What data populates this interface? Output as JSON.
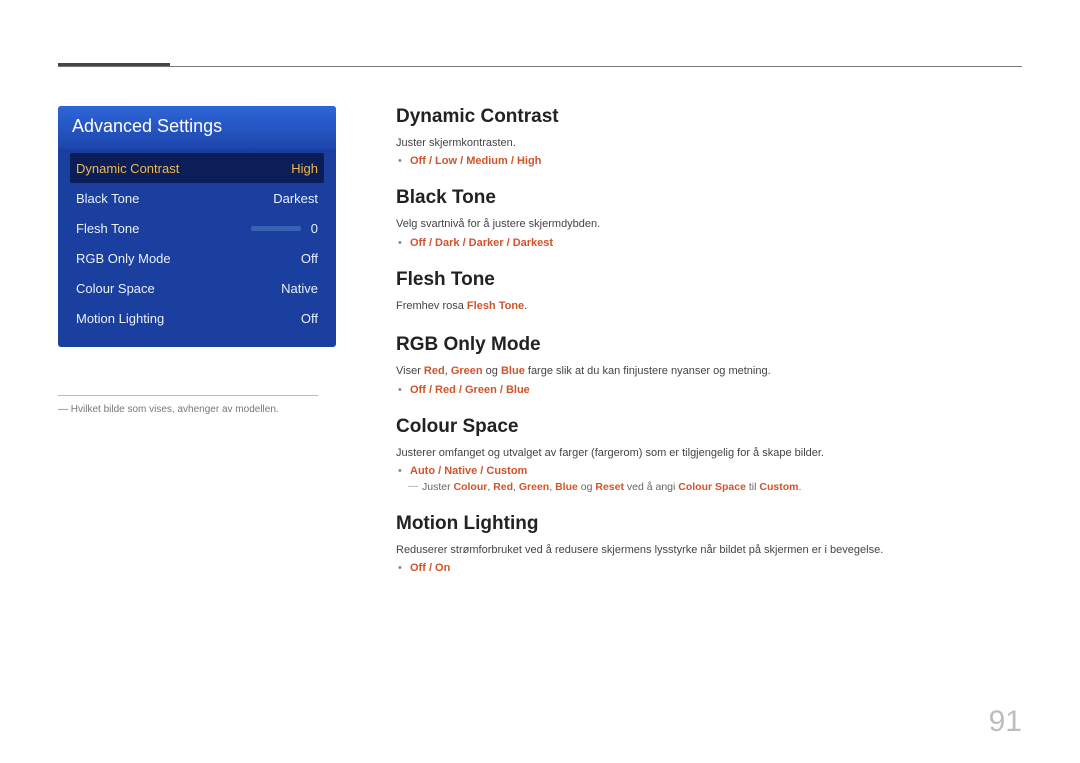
{
  "panel": {
    "title": "Advanced Settings",
    "rows": [
      {
        "label": "Dynamic Contrast",
        "value": "High",
        "selected": true
      },
      {
        "label": "Black Tone",
        "value": "Darkest"
      },
      {
        "label": "Flesh Tone",
        "value": "0",
        "slider": 50
      },
      {
        "label": "RGB Only Mode",
        "value": "Off"
      },
      {
        "label": "Colour Space",
        "value": "Native"
      },
      {
        "label": "Motion Lighting",
        "value": "Off"
      }
    ]
  },
  "footnote_prefix": "―",
  "footnote": "Hvilket bilde som vises, avhenger av modellen.",
  "sections": {
    "dynamic_contrast": {
      "title": "Dynamic Contrast",
      "desc": "Juster skjermkontrasten.",
      "options": "Off / Low / Medium / High"
    },
    "black_tone": {
      "title": "Black Tone",
      "desc": "Velg svartnivå for å justere skjermdybden.",
      "options": "Off / Dark / Darker / Darkest"
    },
    "flesh_tone": {
      "title": "Flesh Tone",
      "desc_pre": "Fremhev rosa ",
      "desc_bold": "Flesh Tone",
      "desc_post": "."
    },
    "rgb_only": {
      "title": "RGB Only Mode",
      "desc_pre": "Viser ",
      "desc_r": "Red",
      "desc_mid1": ", ",
      "desc_g": "Green",
      "desc_mid2": " og ",
      "desc_b": "Blue",
      "desc_post": " farge slik at du kan finjustere nyanser og metning.",
      "options": "Off / Red / Green / Blue"
    },
    "colour_space": {
      "title": "Colour Space",
      "desc": "Justerer omfanget og utvalget av farger (fargerom) som er tilgjengelig for å skape bilder.",
      "options": "Auto / Native / Custom",
      "note_pre": "Juster ",
      "note_c": "Colour",
      "note_s1": ", ",
      "note_r": "Red",
      "note_s2": ", ",
      "note_g": "Green",
      "note_s3": ", ",
      "note_b": "Blue",
      "note_s4": " og ",
      "note_reset": "Reset",
      "note_mid": " ved å angi ",
      "note_cs": "Colour Space",
      "note_to": " til ",
      "note_custom": "Custom",
      "note_end": "."
    },
    "motion_lighting": {
      "title": "Motion Lighting",
      "desc": "Reduserer strømforbruket ved å redusere skjermens lysstyrke når bildet på skjermen er i bevegelse.",
      "options": "Off / On"
    }
  },
  "page_number": "91"
}
